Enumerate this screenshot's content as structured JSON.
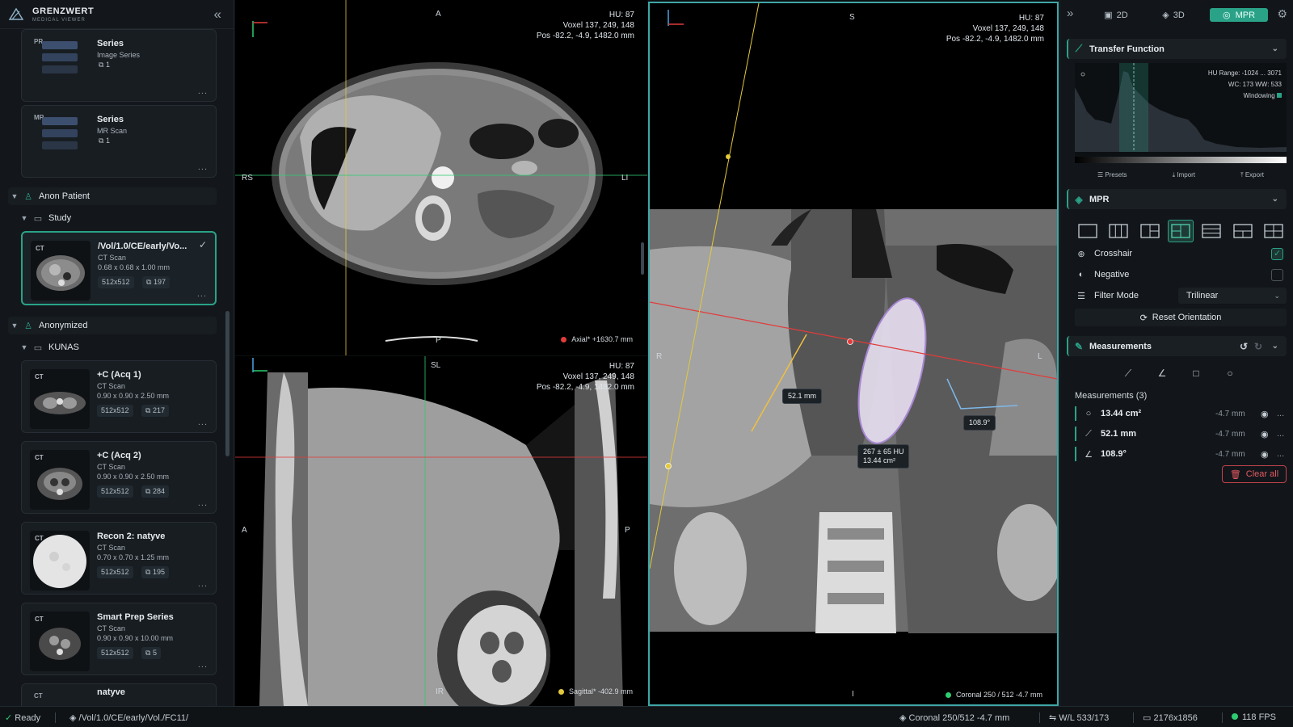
{
  "app": {
    "name": "GRENZWERT",
    "subtitle": "MEDICAL VIEWER"
  },
  "sidebar": {
    "top_cards": [
      {
        "modality": "PR",
        "title": "Series",
        "type": "Image Series",
        "count": "1"
      },
      {
        "modality": "MR",
        "title": "Series",
        "type": "MR Scan",
        "count": "1"
      }
    ],
    "patient1": {
      "name": "Anon Patient",
      "study": "Study"
    },
    "selected_card": {
      "modality": "CT",
      "title": "/Vol/1.0/CE/early/Vo...",
      "type": "CT Scan",
      "dims": "0.68 x 0.68 x 1.00 mm",
      "matrix": "512x512",
      "slices": "197"
    },
    "patient2": {
      "name": "Anonymized",
      "study": "KUNAS"
    },
    "series": [
      {
        "modality": "CT",
        "title": "+C (Acq 1)",
        "type": "CT Scan",
        "dims": "0.90 x 0.90 x 2.50 mm",
        "matrix": "512x512",
        "slices": "217"
      },
      {
        "modality": "CT",
        "title": "+C (Acq 2)",
        "type": "CT Scan",
        "dims": "0.90 x 0.90 x 2.50 mm",
        "matrix": "512x512",
        "slices": "284"
      },
      {
        "modality": "CT",
        "title": "Recon 2: natyve",
        "type": "CT Scan",
        "dims": "0.70 x 0.70 x 1.25 mm",
        "matrix": "512x512",
        "slices": "195"
      },
      {
        "modality": "CT",
        "title": "Smart Prep Series",
        "type": "CT Scan",
        "dims": "0.90 x 0.90 x 10.00 mm",
        "matrix": "512x512",
        "slices": "5"
      },
      {
        "modality": "CT",
        "title": "natyve"
      }
    ],
    "more": "..."
  },
  "viewports": {
    "axial": {
      "hu": "HU: 87",
      "voxel": "Voxel  137, 249, 148",
      "pos": "Pos  -82.2, -4.9, 1482.0 mm",
      "top": "A",
      "left": "RS",
      "right": "LI",
      "bottom": "P",
      "label": "Axial*  +1630.7 mm",
      "color": "#e23b3b"
    },
    "sagittal": {
      "hu": "HU: 87",
      "voxel": "Voxel  137, 249, 148",
      "pos": "Pos  -82.2, -4.9, 1482.0 mm",
      "top": "SL",
      "left": "A",
      "right": "P",
      "bottom": "IR",
      "label": "Sagittal*  -402.9 mm",
      "color": "#e3c93b"
    },
    "coronal": {
      "hu": "HU: 87",
      "voxel": "Voxel  137, 249, 148",
      "pos": "Pos  -82.2, -4.9, 1482.0 mm",
      "top": "S",
      "left": "R",
      "right": "L",
      "bottom": "I",
      "label": "Coronal  250 / 512   -4.7 mm",
      "color": "#2ecc71",
      "measure_dist": "52.1 mm",
      "measure_angle": "108.9°",
      "roi_line1": "267 ± 65 HU",
      "roi_line2": "13.44 cm²"
    }
  },
  "right_panel": {
    "modes": [
      "2D",
      "3D",
      "MPR"
    ],
    "active_mode": "MPR",
    "transfer_function": {
      "title": "Transfer Function",
      "hu_range": "HU Range: -1024 ... 3071",
      "wc_ww": "WC: 173  WW: 533",
      "windowing": "Windowing",
      "buttons": [
        "Presets",
        "Import",
        "Export"
      ]
    },
    "mpr": {
      "title": "MPR",
      "crosshair": "Crosshair",
      "crosshair_on": true,
      "negative": "Negative",
      "negative_on": false,
      "filter_label": "Filter Mode",
      "filter_value": "Trilinear",
      "reset": "Reset Orientation"
    },
    "measurements": {
      "title": "Measurements",
      "header": "Measurements (3)",
      "items": [
        {
          "icon": "circle",
          "value": "13.44 cm²",
          "z": "-4.7 mm"
        },
        {
          "icon": "ruler",
          "value": "52.1 mm",
          "z": "-4.7 mm"
        },
        {
          "icon": "angle",
          "value": "108.9°",
          "z": "-4.7 mm"
        }
      ],
      "clear": "Clear all"
    }
  },
  "status": {
    "ready": "Ready",
    "path": "/Vol/1.0/CE/early/Vol./FC11/",
    "slice": "Coronal 250/512 -4.7 mm",
    "wl": "W/L 533/173",
    "resolution": "2176x1856",
    "fps": "118 FPS"
  },
  "colors": {
    "accent": "#2aa287",
    "axial": "#e23b3b",
    "sagittal": "#e3c93b",
    "coronal": "#2ecc71",
    "danger": "#e35a62"
  }
}
